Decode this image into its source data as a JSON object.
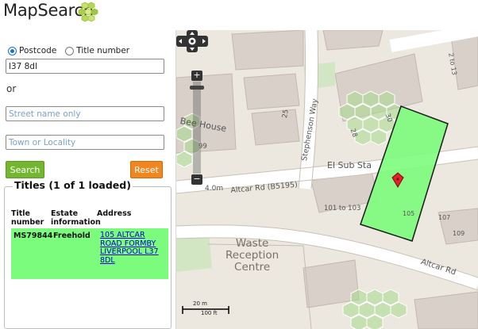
{
  "app": {
    "title": "MapSearch"
  },
  "search": {
    "mode_options": [
      {
        "label": "Postcode",
        "selected": true
      },
      {
        "label": "Title number",
        "selected": false
      }
    ],
    "query_value": "l37 8dl",
    "or_text": "or",
    "street_placeholder": "Street name only",
    "town_placeholder": "Town or Locality",
    "search_label": "Search",
    "reset_label": "Reset"
  },
  "titles": {
    "heading": "Titles (1 of 1 loaded)",
    "columns": [
      "Title number",
      "Estate information",
      "Address"
    ],
    "rows": [
      {
        "title_number": "MS79844",
        "estate": "Freehold",
        "address": "105 ALTCAR ROAD FORMBY LIVERPOOL L37 8DL"
      }
    ]
  },
  "map": {
    "labels": {
      "road_main": "Altcar Rd (B5195)",
      "road_lower": "Altcar Rd",
      "stephenson": "Stephenson Way",
      "sub_station": "El Sub Sta",
      "waste": "Waste\nReception\nCentre",
      "house": "Bee House",
      "spot_height": "4.0m",
      "range_101_103": "101 to 103",
      "n99": "99",
      "n25": "25",
      "n28": "28",
      "n30": "30",
      "n107": "107",
      "n109": "109",
      "n105": "105",
      "range_2_13": "2 to 13"
    },
    "scale": {
      "metric": "20 m",
      "imperial": "100 ft"
    },
    "colors": {
      "parcel": "#7cfc7c",
      "parcel_border": "#1a1a1a",
      "marker": "#e0202a",
      "hex_overlay": "#a8d88a"
    },
    "controls": {
      "zoom_in": "+",
      "zoom_out": "−"
    }
  }
}
